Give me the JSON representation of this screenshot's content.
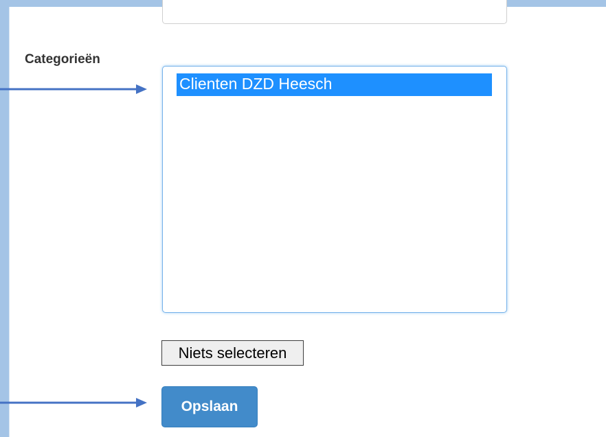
{
  "form": {
    "category_label": "Categorieën",
    "categories": [
      {
        "label": "Clienten DZD Heesch",
        "selected": true
      }
    ],
    "clear_selection_label": "Niets selecteren",
    "save_label": "Opslaan"
  },
  "colors": {
    "frame": "#a4c4e6",
    "selection": "#1e90ff",
    "primary_button": "#428bca",
    "annotation_arrow": "#4472c4"
  },
  "annotations": {
    "arrows": [
      "arrow-to-category-list",
      "arrow-to-save-button"
    ]
  }
}
